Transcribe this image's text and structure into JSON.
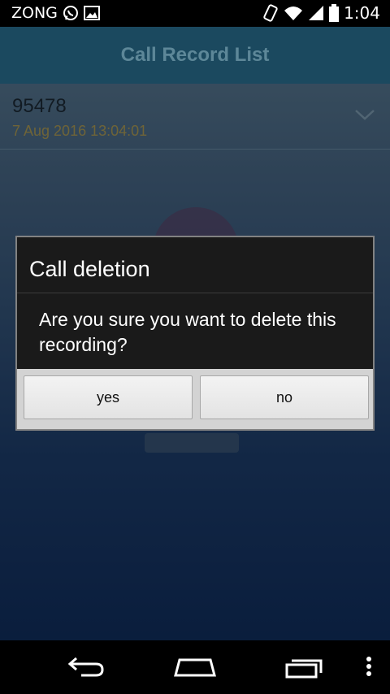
{
  "status_bar": {
    "carrier": "ZONG",
    "time": "1:04"
  },
  "app": {
    "title": "Call Record List",
    "list": [
      {
        "number": "95478",
        "date": "7 Aug 2016 13:04:01"
      }
    ]
  },
  "dialog": {
    "title": "Call deletion",
    "message": "Are you sure you want to delete this recording?",
    "yes_label": "yes",
    "no_label": "no"
  },
  "icons": {
    "status": [
      "whatsapp-icon",
      "image-icon",
      "vibrate-icon",
      "wifi-icon",
      "signal-icon",
      "battery-icon"
    ],
    "nav": [
      "back-icon",
      "home-icon",
      "recents-icon",
      "menu-icon"
    ]
  }
}
